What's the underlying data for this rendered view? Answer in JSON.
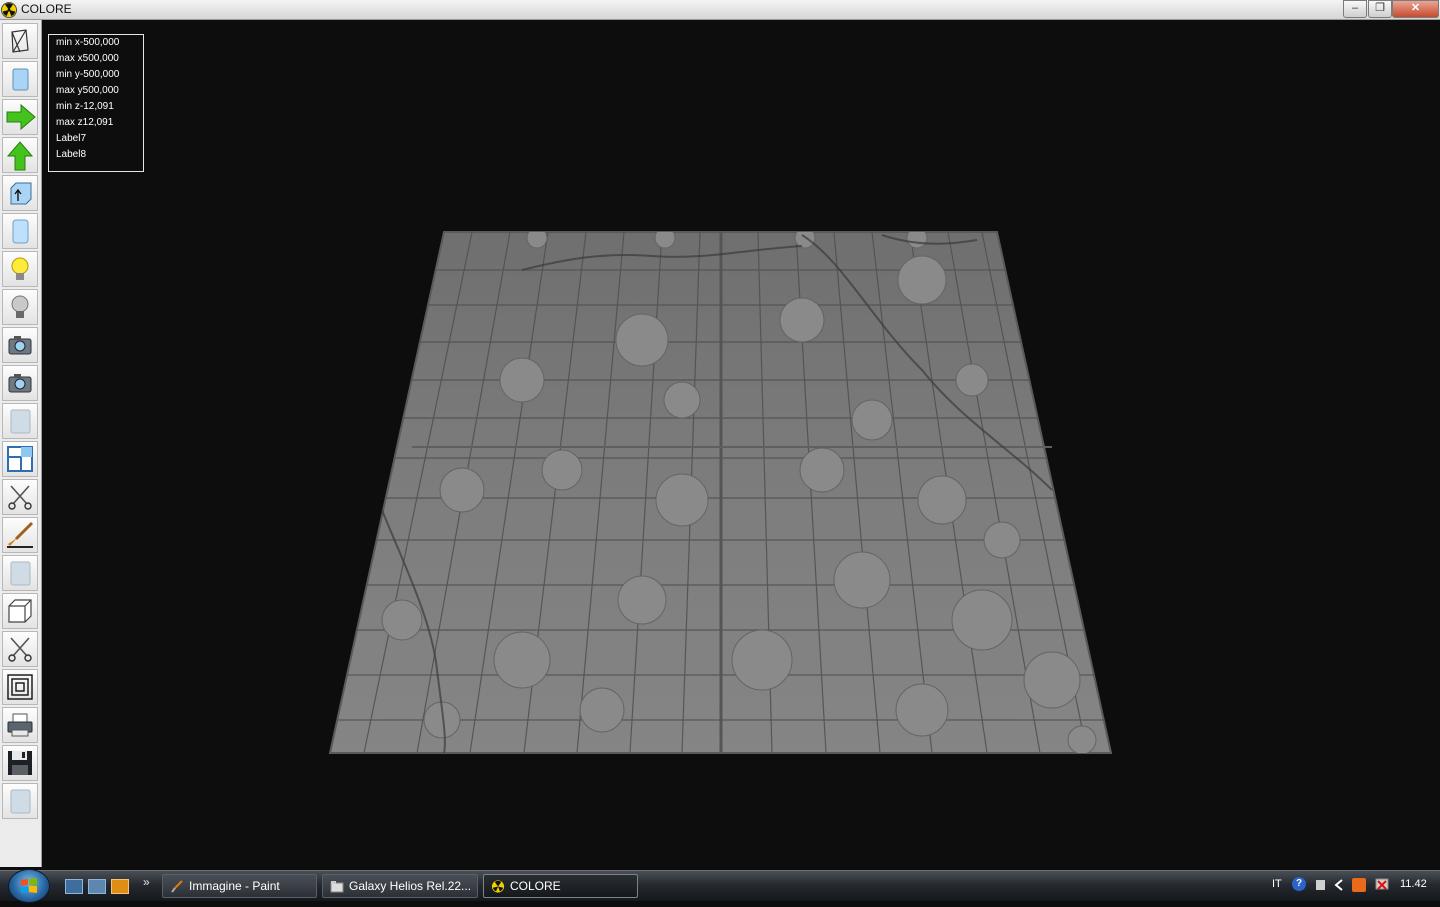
{
  "window": {
    "title": "COLORE",
    "minimize": "–",
    "maximize": "❐",
    "close": "✕"
  },
  "toolbar": {
    "tools": [
      "wireframe-icon",
      "solid-cylinder-icon",
      "arrow-right-icon",
      "arrow-up-icon",
      "extrude-icon",
      "cylinder-icon",
      "light-on-icon",
      "light-off-icon",
      "camera-icon",
      "camera-icon",
      "texture-icon",
      "window-split-icon",
      "scissors-icon",
      "paint-brush-icon",
      "texture-icon",
      "cube-icon",
      "scissors-icon",
      "concentric-squares-icon",
      "printer-icon",
      "save-icon",
      "texture-icon"
    ]
  },
  "info": {
    "min_x": "min x-500,000",
    "max_x": "max x500,000",
    "min_y": "min y-500,000",
    "max_y": "max y500,000",
    "min_z": "min z-12,091",
    "max_z": "max z12,091",
    "label7": "Label7",
    "label8": "Label8"
  },
  "taskbar": {
    "quicklaunch_more": "»",
    "tasks": [
      {
        "label": "Immagine - Paint",
        "active": false
      },
      {
        "label": "Galaxy Helios  Rel.22...",
        "active": false
      },
      {
        "label": "COLORE",
        "active": true
      }
    ],
    "language": "IT",
    "help": "?",
    "clock": "11.42"
  },
  "colors": {
    "background": "#0d0d0d",
    "surface": "#7e7e7e",
    "arrow_green": "#44c21d"
  }
}
